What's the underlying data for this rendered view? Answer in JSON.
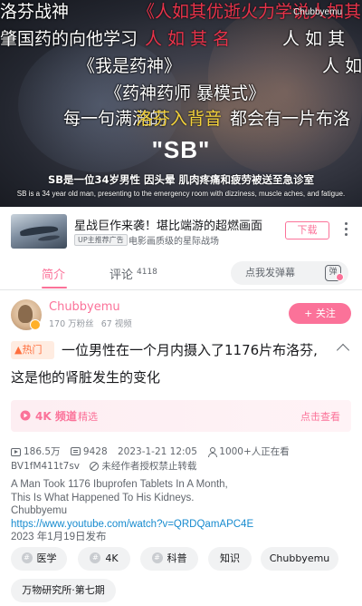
{
  "video": {
    "danmaku": [
      {
        "text": "洛芬战神",
        "color": "white"
      },
      {
        "text": "《人如其优逝火力学说人如其",
        "color": "red"
      },
      {
        "text": "肇国药的向他学习",
        "color": "white"
      },
      {
        "text": "人 如 其 名",
        "color": "red"
      },
      {
        "text": "人 如 其",
        "color": "white"
      },
      {
        "text": "《我是药神》",
        "color": "white"
      },
      {
        "text": "人 如",
        "color": "white"
      },
      {
        "text": "《药神药师 暴模式》",
        "color": "white"
      },
      {
        "text": "每一句满满的",
        "color": "white"
      },
      {
        "text": "都会有一片布洛",
        "color": "white"
      },
      {
        "text": "洛芬入背音",
        "color": "yellow"
      }
    ],
    "watermark": "Chubbyemu",
    "caption_big": "\"SB\"",
    "subtitle_cn": "SB是一位34岁男性 因头晕 肌肉疼痛和疲劳被送至急诊室",
    "subtitle_en": "SB is a 34 year old man, presenting to the emergency room with dizziness, muscle aches, and fatigue."
  },
  "ad": {
    "title": "星战巨作来袭！堪比端游的超燃画面",
    "tag": "UP主推荐广告",
    "description": "电影画质级的星际战场",
    "button": "下载"
  },
  "tabs": {
    "intro": "简介",
    "comments": "评论",
    "comment_count": "4118",
    "danmaku_placeholder": "点我发弹幕",
    "danmaku_toggle": "弹"
  },
  "uploader": {
    "name": "Chubbyemu",
    "followers": "170 万粉丝",
    "videos": "67 视频",
    "follow": "+ 关注"
  },
  "title": {
    "hot_badge": "热门",
    "line1": "一位男性在一个月内摄入了1176片布洛芬,",
    "line2": "这是他的肾脏发生的变化"
  },
  "channel_card": {
    "label": "4K 频道",
    "sub": "精选",
    "action": "点击查看"
  },
  "meta": {
    "views": "186.5万",
    "danmaku_count": "9428",
    "date": "2023-1-21 12:05",
    "watching": "1000+人正在看",
    "bvid": "BV1fM411t7sv",
    "no_repost": "未经作者授权禁止转载"
  },
  "description": {
    "line1": "A Man Took 1176 Ibuprofen Tablets In A Month,",
    "line2": "This Is What Happened To His Kidneys.",
    "line3": "Chubbyemu",
    "link": "https://www.youtube.com/watch?v=QRDQamAPC4E",
    "published": "2023 年1月19日发布"
  },
  "tags": [
    "医学",
    "4K",
    "科普",
    "知识",
    "Chubbyemu",
    "万物研究所·第七期"
  ],
  "colors": {
    "accent": "#fb7299",
    "hot": "#ff6f3e",
    "link": "#178bcf",
    "danmaku_red": "#e8334a"
  }
}
